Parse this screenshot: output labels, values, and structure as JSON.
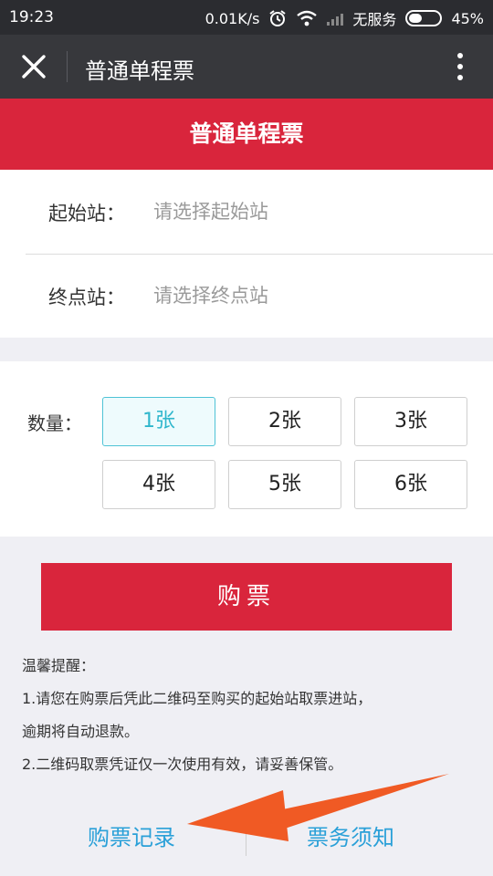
{
  "status_bar": {
    "time": "19:23",
    "speed": "0.01K/s",
    "service": "无服务",
    "battery": "45%"
  },
  "nav": {
    "title": "普通单程票"
  },
  "banner": {
    "title": "普通单程票"
  },
  "stations": {
    "start_label": "起始站：",
    "start_placeholder": "请选择起始站",
    "end_label": "终点站：",
    "end_placeholder": "请选择终点站"
  },
  "quantity": {
    "label": "数量：",
    "options": [
      "1张",
      "2张",
      "3张",
      "4张",
      "5张",
      "6张"
    ],
    "selected": "1张"
  },
  "buy_button": "购票",
  "tips": {
    "heading": "温馨提醒：",
    "line1": "1.请您在购票后凭此二维码至购买的起始站取票进站，",
    "line2": "逾期将自动退款。",
    "line3": "2.二维码取票凭证仅一次使用有效，请妥善保管。"
  },
  "footer": {
    "records": "购票记录",
    "notice": "票务须知"
  },
  "colors": {
    "brand_red": "#d9253c",
    "link_blue": "#2aa0d8",
    "selected_cyan": "#4fc3d6",
    "arrow_orange": "#f05a24"
  }
}
